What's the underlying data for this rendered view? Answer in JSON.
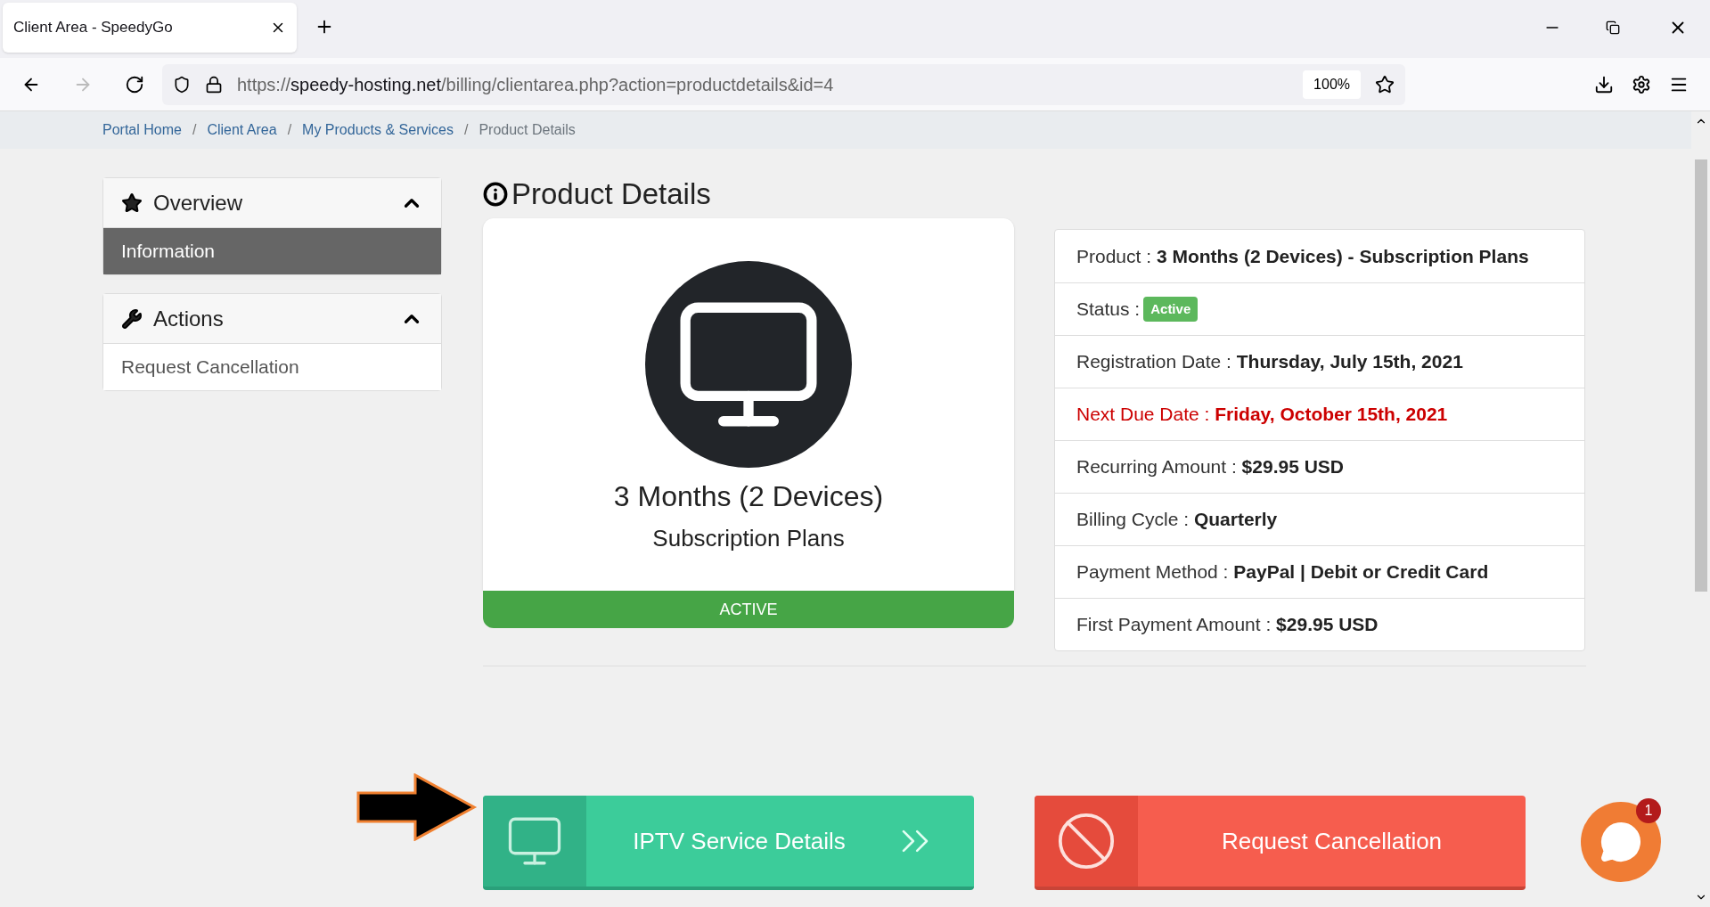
{
  "browser": {
    "tab_title": "Client Area - SpeedyGo",
    "url_prefix": "https://",
    "url_host": "speedy-hosting.net",
    "url_path": "/billing/clientarea.php?action=productdetails&id=4",
    "zoom": "100%"
  },
  "breadcrumb": [
    {
      "kind": "link",
      "label": "Portal Home"
    },
    {
      "kind": "separator",
      "label": "/"
    },
    {
      "kind": "link",
      "label": "Client Area"
    },
    {
      "kind": "separator",
      "label": "/"
    },
    {
      "kind": "link",
      "label": "My Products & Services"
    },
    {
      "kind": "separator",
      "label": "/"
    },
    {
      "kind": "current",
      "label": "Product Details"
    }
  ],
  "sidebar": [
    {
      "title": "Overview",
      "expanded": true,
      "items": [
        {
          "label": "Information",
          "selected": true
        }
      ]
    },
    {
      "title": "Actions",
      "expanded": true,
      "items": [
        {
          "label": "Request Cancellation",
          "selected": false
        }
      ]
    }
  ],
  "page_title": "Product Details",
  "product_card": {
    "name": "3 Months (2 Devices)",
    "group": "Subscription Plans",
    "status": "ACTIVE"
  },
  "details": [
    {
      "kind": "text",
      "label": "Product :",
      "value": "3 Months (2 Devices) - Subscription Plans"
    },
    {
      "kind": "badge",
      "label": "Status :",
      "value": "Active"
    },
    {
      "kind": "text",
      "label": "Registration Date :",
      "value": "Thursday, July 15th, 2021"
    },
    {
      "kind": "due",
      "label": "Next Due Date :",
      "value": "Friday, October 15th, 2021"
    },
    {
      "kind": "text",
      "label": "Recurring Amount :",
      "value": "$29.95 USD"
    },
    {
      "kind": "text",
      "label": "Billing Cycle :",
      "value": "Quarterly"
    },
    {
      "kind": "text",
      "label": "Payment Method :",
      "value": "PayPal | Debit or Credit Card"
    },
    {
      "kind": "text",
      "label": "First Payment Amount :",
      "value": "$29.95 USD"
    }
  ],
  "actions": [
    {
      "kind": "service",
      "label": "IPTV Service Details"
    },
    {
      "kind": "cancel",
      "label": "Request Cancellation"
    }
  ],
  "chat": {
    "badge": "1"
  }
}
